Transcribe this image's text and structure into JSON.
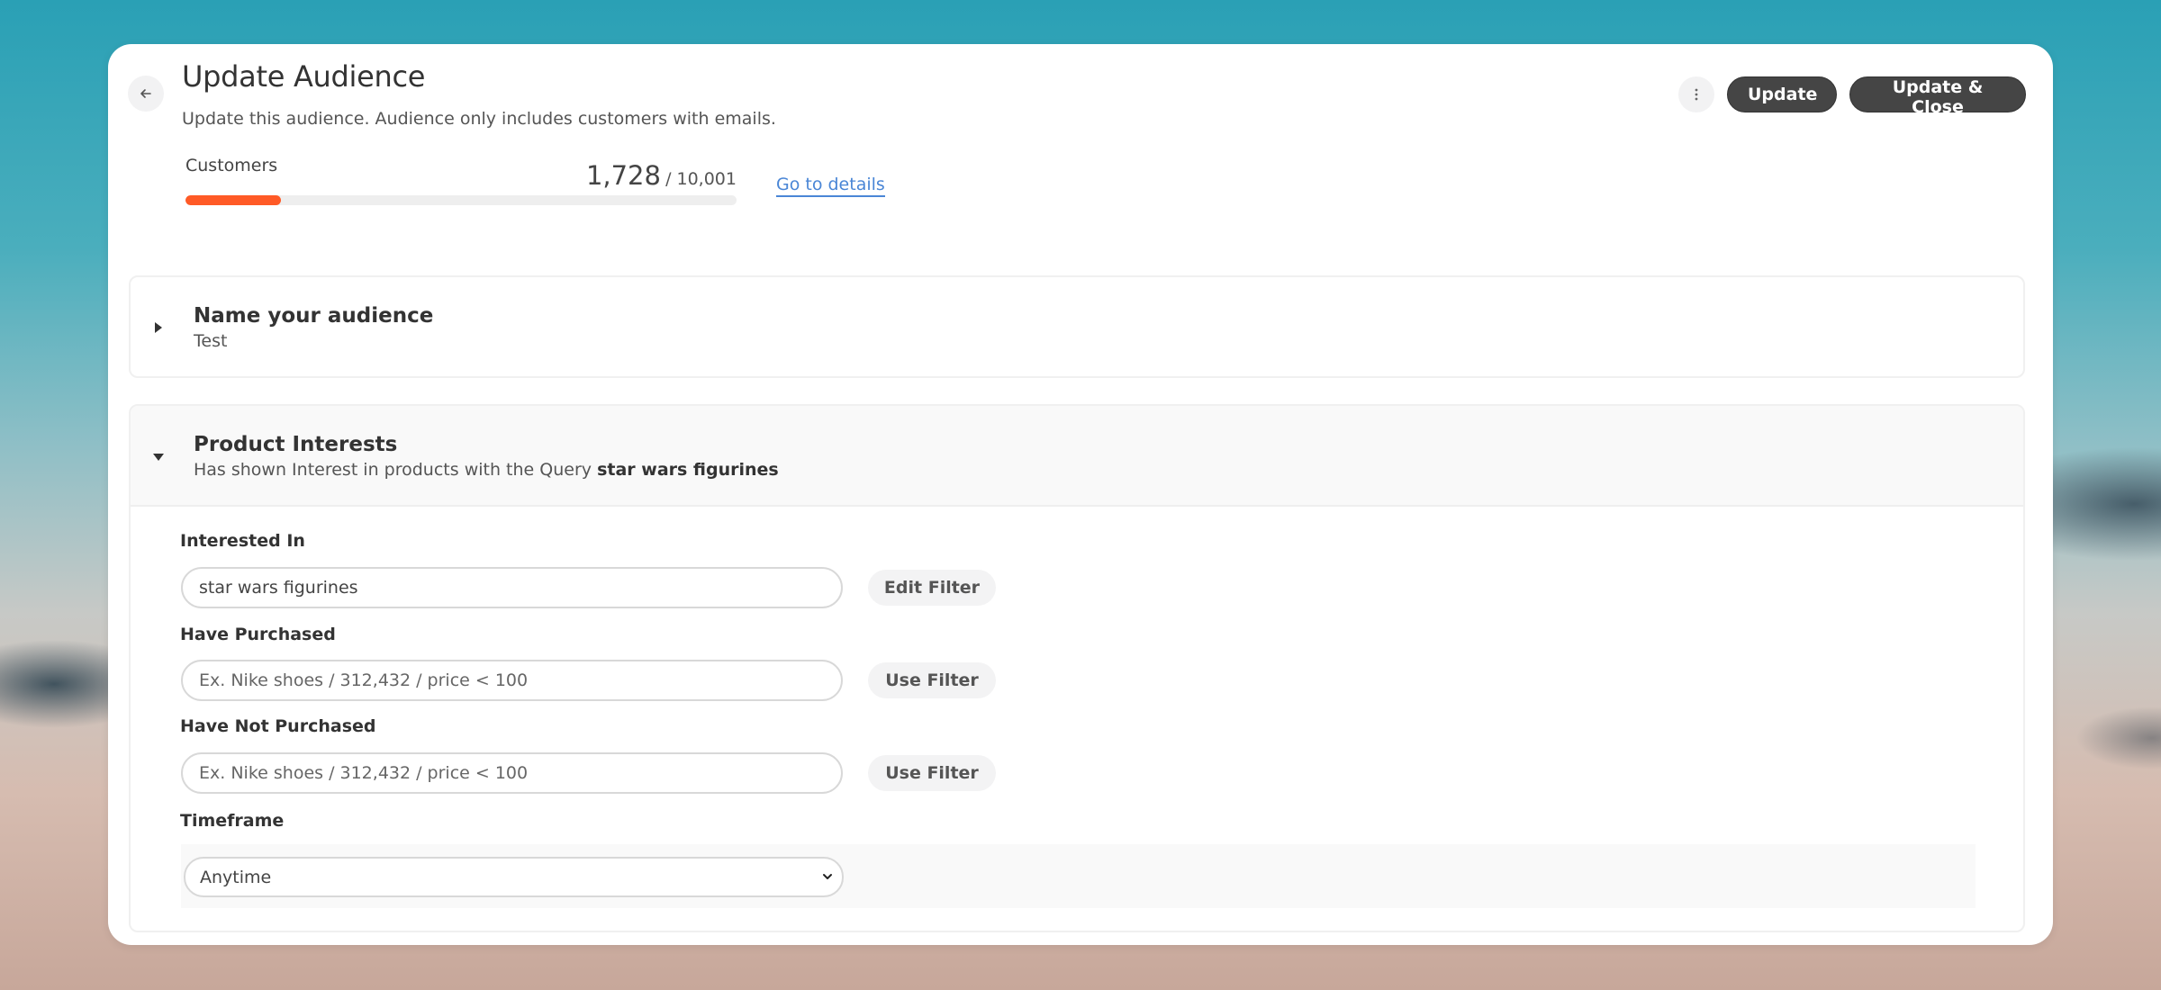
{
  "header": {
    "title": "Update Audience",
    "subtitle": "Update this audience. Audience only includes customers with emails.",
    "back_icon": "arrow-left-icon",
    "more_icon": "kebab-vertical-icon",
    "buttons": {
      "update": "Update",
      "update_close": "Update & Close"
    }
  },
  "customers": {
    "label": "Customers",
    "count": "1,728",
    "total": "/ 10,001",
    "progress_fraction": 0.1728,
    "link": "Go to details",
    "accent_color": "#ff5a26"
  },
  "sections": {
    "name": {
      "title": "Name your audience",
      "value": "Test",
      "expanded": false,
      "caret_icon": "caret-right-icon"
    },
    "interests": {
      "title": "Product Interests",
      "summary_prefix": "Has shown Interest in products with the Query",
      "summary_query": "star wars figurines",
      "expanded": true,
      "caret_icon": "caret-down-icon",
      "fields": {
        "interested_in": {
          "label": "Interested In",
          "value": "star wars figurines",
          "button": "Edit Filter"
        },
        "have_purchased": {
          "label": "Have Purchased",
          "value": "",
          "placeholder": "Ex. Nike shoes / 312,432 / price < 100",
          "button": "Use Filter"
        },
        "have_not_purchased": {
          "label": "Have Not Purchased",
          "value": "",
          "placeholder": "Ex. Nike shoes / 312,432 / price < 100",
          "button": "Use Filter"
        },
        "timeframe": {
          "label": "Timeframe",
          "selected": "Anytime"
        }
      }
    }
  }
}
